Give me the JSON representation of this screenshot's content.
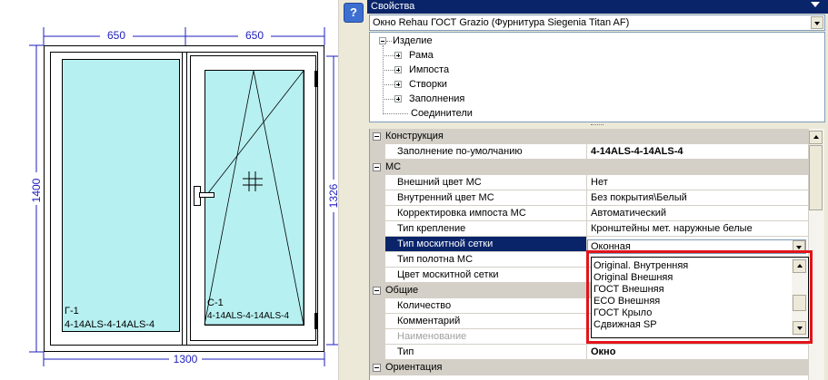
{
  "drawing": {
    "dim_top_left": "650",
    "dim_top_right": "650",
    "dim_left": "1400",
    "dim_right": "1326",
    "dim_bottom": "1300",
    "pane_left_name": "Г-1",
    "pane_left_glass": "4-14ALS-4-14ALS-4",
    "pane_right_name": "С-1",
    "pane_right_glass": "4-14ALS-4-14ALS-4",
    "frame_color": "#ffffff",
    "glass_color": "#b7f0f1",
    "dimension_color": "#1d1dbd"
  },
  "help_button": {
    "label": "?"
  },
  "panel": {
    "title": "Свойства",
    "product": "Окно Rehau ГОСТ Grazio (Фурнитура Siegenia Titan AF)"
  },
  "tree": {
    "root": "Изделие",
    "children": [
      "Рама",
      "Импоста",
      "Створки",
      "Заполнения",
      "Соединители"
    ]
  },
  "grid": {
    "rows": [
      {
        "type": "category",
        "label": "Конструкция"
      },
      {
        "type": "prop",
        "name": "Заполнение по-умолчанию",
        "value": "4-14ALS-4-14ALS-4",
        "bold": true
      },
      {
        "type": "category",
        "label": "МС"
      },
      {
        "type": "prop",
        "name": "Внешний цвет МС",
        "value": "Нет"
      },
      {
        "type": "prop",
        "name": "Внутренний цвет МС",
        "value": "Без покрытия\\Белый"
      },
      {
        "type": "prop",
        "name": "Корректировка импоста МС",
        "value": "Автоматический"
      },
      {
        "type": "prop",
        "name": "Тип крепление",
        "value": "Кронштейны мет. наружные белые"
      },
      {
        "type": "prop",
        "name": "Тип москитной сетки",
        "value": "",
        "selected": true
      },
      {
        "type": "prop",
        "name": "Тип полотна МС",
        "value": ""
      },
      {
        "type": "prop",
        "name": "Цвет москитной сетки",
        "value": ""
      },
      {
        "type": "category",
        "label": "Общие"
      },
      {
        "type": "prop",
        "name": "Количество",
        "value": ""
      },
      {
        "type": "prop",
        "name": "Комментарий",
        "value": ""
      },
      {
        "type": "prop",
        "name": "Наименование",
        "value": "",
        "disabled": true
      },
      {
        "type": "prop",
        "name": "Тип",
        "value": "Окно",
        "bold": true
      },
      {
        "type": "category",
        "label": "Ориентация"
      }
    ]
  },
  "combo": {
    "value": "Оконная"
  },
  "dropdown": {
    "options": [
      "Original. Внутренняя",
      "Original Внешняя",
      "ГОСТ Внешняя",
      "ECO Внешняя",
      "ГОСТ Крыло",
      "Сдвижная SP"
    ]
  },
  "highlight_color": "#e3141b"
}
